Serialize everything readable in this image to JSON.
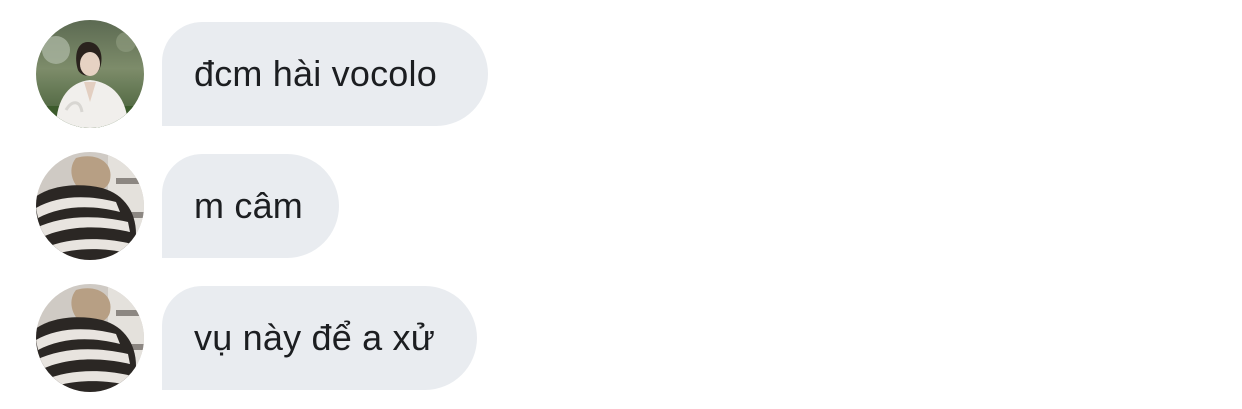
{
  "colors": {
    "bubble_background": "#e9ecf0",
    "message_text": "#1c1e21",
    "page_background": "#ffffff"
  },
  "messages": [
    {
      "text": "đcm hài vocolo",
      "avatar": "avatar-woman-white-shirt"
    },
    {
      "text": "m câm",
      "avatar": "avatar-person-striped-sweater"
    },
    {
      "text": "vụ này để a xử",
      "avatar": "avatar-person-striped-sweater"
    }
  ]
}
